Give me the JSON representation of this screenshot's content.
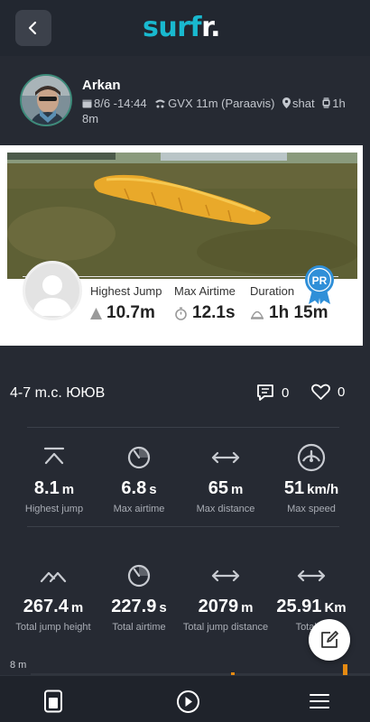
{
  "header": {
    "logo_main": "surf",
    "logo_tail": "r.",
    "back_icon": "chevron-left-icon"
  },
  "profile": {
    "name": "Arkan",
    "date": "8/6 -14:44",
    "gear": "GVX 11m (Paraavis)",
    "location": "shat",
    "duration": "1h 8m"
  },
  "card": {
    "highest_jump_label": "Highest Jump",
    "highest_jump_value": "10.7m",
    "max_airtime_label": "Max Airtime",
    "max_airtime_value": "12.1s",
    "duration_label": "Duration",
    "duration_value": "1h 15m",
    "badge": "PR"
  },
  "session": {
    "title": "4-7 m.c. ЮЮВ",
    "comments": "0",
    "likes": "0"
  },
  "stats_row1": [
    {
      "value": "8.1",
      "unit": "m",
      "label": "Highest jump",
      "icon": "jump-up-icon"
    },
    {
      "value": "6.8",
      "unit": "s",
      "label": "Max airtime",
      "icon": "timer-icon"
    },
    {
      "value": "65",
      "unit": "m",
      "label": "Max distance",
      "icon": "distance-arrows-icon"
    },
    {
      "value": "51",
      "unit": "km/h",
      "label": "Max speed",
      "icon": "speedometer-icon"
    }
  ],
  "stats_row2": [
    {
      "value": "267.4",
      "unit": "m",
      "label": "Total jump height",
      "icon": "jumps-icon"
    },
    {
      "value": "227.9",
      "unit": "s",
      "label": "Total airtime",
      "icon": "timer-icon"
    },
    {
      "value": "2079",
      "unit": "m",
      "label": "Total jump distance",
      "icon": "distance-arrows-icon"
    },
    {
      "value": "25.91",
      "unit": "Km",
      "label": "Total di",
      "icon": "distance-arrows-icon"
    }
  ],
  "chart": {
    "label": "8 m"
  },
  "nav": {
    "items": [
      "session-icon",
      "play-icon",
      "menu-icon"
    ]
  },
  "colors": {
    "background": "#262a33",
    "accent": "#19b9cf",
    "badge": "#2f8fd8",
    "bar": "#e58a12"
  }
}
